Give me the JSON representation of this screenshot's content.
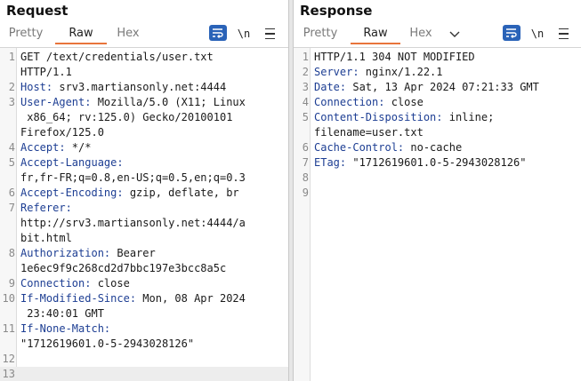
{
  "request": {
    "title": "Request",
    "tabs": [
      "Pretty",
      "Raw",
      "Hex"
    ],
    "active_tab": "Raw",
    "newline_label": "\\n",
    "lines": [
      {
        "n": "1",
        "parts": [
          {
            "t": "GET /text/credentials/user.txt"
          }
        ]
      },
      {
        "n": "",
        "parts": [
          {
            "t": "HTTP/1.1"
          }
        ]
      },
      {
        "n": "2",
        "parts": [
          {
            "t": "Host:",
            "h": true
          },
          {
            "t": " srv3.martiansonly.net:4444"
          }
        ]
      },
      {
        "n": "3",
        "parts": [
          {
            "t": "User-Agent:",
            "h": true
          },
          {
            "t": " Mozilla/5.0 (X11; Linux"
          }
        ]
      },
      {
        "n": "",
        "parts": [
          {
            "t": " x86_64; rv:125.0) Gecko/20100101"
          }
        ]
      },
      {
        "n": "",
        "parts": [
          {
            "t": "Firefox/125.0"
          }
        ]
      },
      {
        "n": "4",
        "parts": [
          {
            "t": "Accept:",
            "h": true
          },
          {
            "t": " */*"
          }
        ]
      },
      {
        "n": "5",
        "parts": [
          {
            "t": "Accept-Language:",
            "h": true
          }
        ]
      },
      {
        "n": "",
        "parts": [
          {
            "t": "fr,fr-FR;q=0.8,en-US;q=0.5,en;q=0.3"
          }
        ]
      },
      {
        "n": "6",
        "parts": [
          {
            "t": "Accept-Encoding:",
            "h": true
          },
          {
            "t": " gzip, deflate, br"
          }
        ]
      },
      {
        "n": "7",
        "parts": [
          {
            "t": "Referer:",
            "h": true
          }
        ]
      },
      {
        "n": "",
        "parts": [
          {
            "t": "http://srv3.martiansonly.net:4444/a"
          }
        ]
      },
      {
        "n": "",
        "parts": [
          {
            "t": "bit.html"
          }
        ]
      },
      {
        "n": "8",
        "parts": [
          {
            "t": "Authorization:",
            "h": true
          },
          {
            "t": " Bearer"
          }
        ]
      },
      {
        "n": "",
        "parts": [
          {
            "t": "1e6ec9f9c268cd2d7bbc197e3bcc8a5c"
          }
        ]
      },
      {
        "n": "9",
        "parts": [
          {
            "t": "Connection:",
            "h": true
          },
          {
            "t": " close"
          }
        ]
      },
      {
        "n": "10",
        "parts": [
          {
            "t": "If-Modified-Since:",
            "h": true
          },
          {
            "t": " Mon, 08 Apr 2024"
          }
        ]
      },
      {
        "n": "",
        "parts": [
          {
            "t": " 23:40:01 GMT"
          }
        ]
      },
      {
        "n": "11",
        "parts": [
          {
            "t": "If-None-Match:",
            "h": true
          }
        ]
      },
      {
        "n": "",
        "parts": [
          {
            "t": "\"1712619601.0-5-2943028126\""
          }
        ]
      },
      {
        "n": "12",
        "parts": []
      },
      {
        "n": "13",
        "parts": [],
        "cursor": true
      }
    ]
  },
  "response": {
    "title": "Response",
    "tabs": [
      "Pretty",
      "Raw",
      "Hex"
    ],
    "active_tab": "Raw",
    "newline_label": "\\n",
    "lines": [
      {
        "n": "1",
        "parts": [
          {
            "t": "HTTP/1.1 304 NOT MODIFIED"
          }
        ]
      },
      {
        "n": "2",
        "parts": [
          {
            "t": "Server:",
            "h": true
          },
          {
            "t": " nginx/1.22.1"
          }
        ]
      },
      {
        "n": "3",
        "parts": [
          {
            "t": "Date:",
            "h": true
          },
          {
            "t": " Sat, 13 Apr 2024 07:21:33 GMT"
          }
        ]
      },
      {
        "n": "4",
        "parts": [
          {
            "t": "Connection:",
            "h": true
          },
          {
            "t": " close"
          }
        ]
      },
      {
        "n": "5",
        "parts": [
          {
            "t": "Content-Disposition:",
            "h": true
          },
          {
            "t": " inline;"
          }
        ]
      },
      {
        "n": "",
        "parts": [
          {
            "t": "filename=user.txt"
          }
        ]
      },
      {
        "n": "6",
        "parts": [
          {
            "t": "Cache-Control:",
            "h": true
          },
          {
            "t": " no-cache"
          }
        ]
      },
      {
        "n": "7",
        "parts": [
          {
            "t": "ETag:",
            "h": true
          },
          {
            "t": " \"1712619601.0-5-2943028126\""
          }
        ]
      },
      {
        "n": "8",
        "parts": []
      },
      {
        "n": "9",
        "parts": []
      }
    ]
  },
  "colors": {
    "accent": "#e8743b",
    "header_name": "#1d3e93",
    "wrap_button": "#2a63b8"
  }
}
